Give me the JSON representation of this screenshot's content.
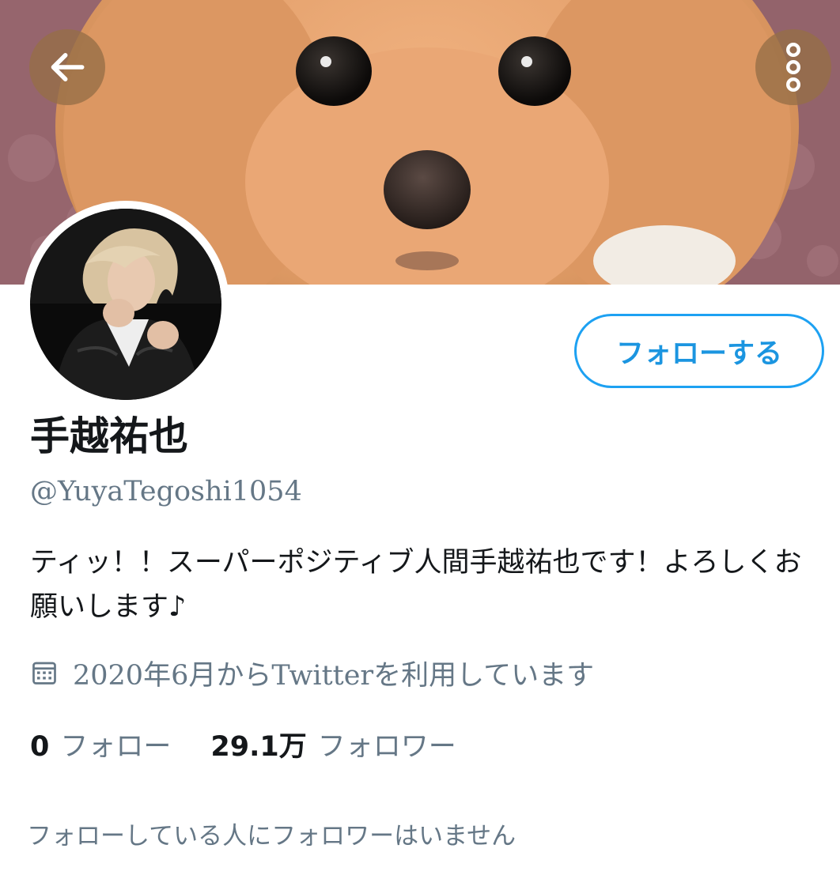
{
  "header": {
    "back_icon": "arrow-left-icon",
    "more_icon": "more-vertical-icon"
  },
  "profile": {
    "display_name": "手越祐也",
    "handle": "@YuyaTegoshi1054",
    "follow_button_label": "フォローする",
    "bio": "ティッ！！スーパーポジティブ人間手越祐也です！よろしくお願いします♪",
    "joined": "2020年6月からTwitterを利用しています",
    "joined_icon": "calendar-icon",
    "stats": {
      "following_count": "0",
      "following_label": "フォロー",
      "followers_count": "29.1万",
      "followers_label": "フォロワー"
    },
    "mutual_followers_text": "フォローしている人にフォロワーはいません"
  },
  "colors": {
    "accent": "#1da1f2",
    "text_primary": "#14171a",
    "text_secondary": "#657786"
  }
}
